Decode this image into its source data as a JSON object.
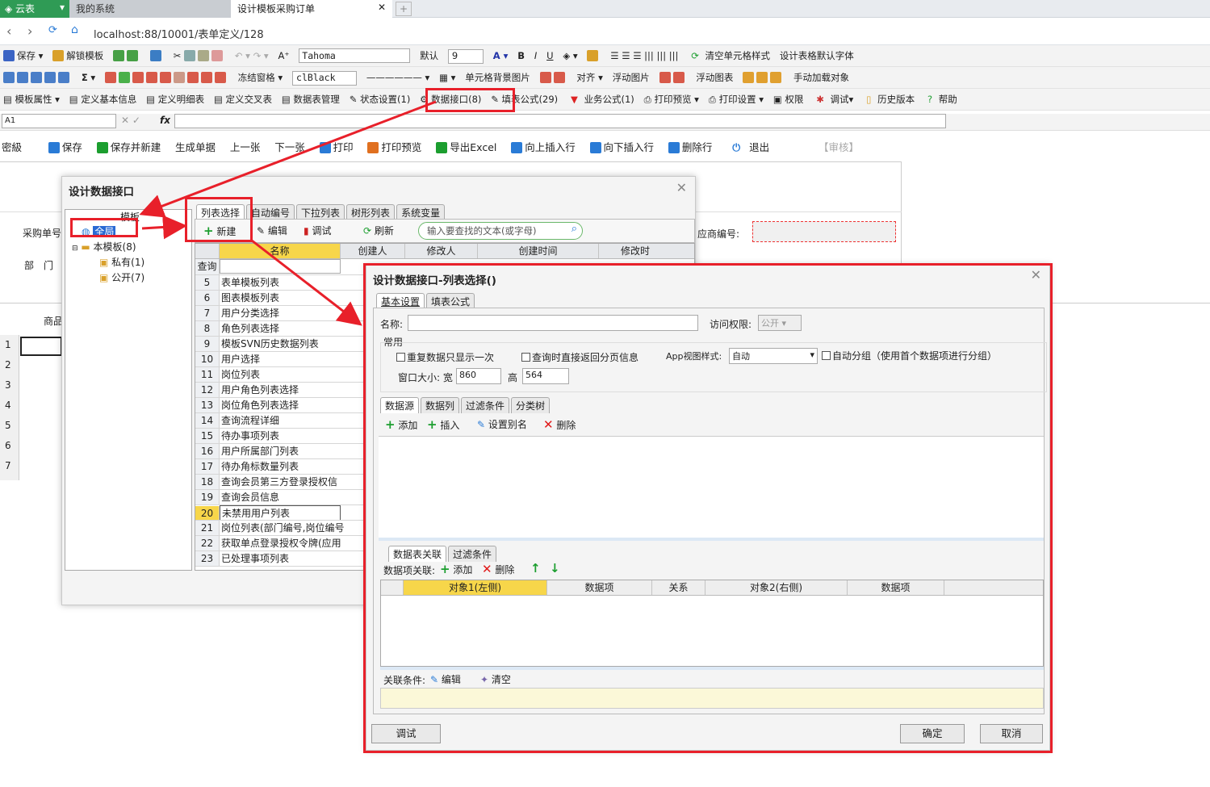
{
  "app": {
    "app_tab": "云表",
    "system_tab": "我的系统",
    "doc_tab": "设计模板采购订单",
    "url": "localhost:88/10001/表单定义/128"
  },
  "toolbar1": {
    "save": "保存",
    "unlock": "解锁模板",
    "font_label": "A⁺",
    "font_name": "Tahoma",
    "default": "默认",
    "size": "9",
    "clear_style": "清空单元格样式",
    "default_font": "设计表格默认字体",
    "B": "B",
    "I": "I",
    "U": "U"
  },
  "toolbar2": {
    "freeze": "冻结窗格",
    "color_name": "clBlack",
    "cell_bg": "单元格背景图片",
    "align": "对齐",
    "float_img": "浮动图片",
    "float_chart": "浮动图表",
    "manual_load": "手动加载对象",
    "sigma": "Σ"
  },
  "toolbar3": {
    "template_props": "模板属性",
    "define_basic": "定义基本信息",
    "define_detail": "定义明细表",
    "define_cross": "定义交叉表",
    "data_table": "数据表管理",
    "state": "状态设置(1)",
    "data_interface": "数据接口(8)",
    "fill_formula": "填表公式(29)",
    "biz_formula": "业务公式(1)",
    "print_preview": "打印预览",
    "print_settings": "打印设置",
    "permission": "权限",
    "debug": "调试",
    "history": "历史版本",
    "help": "帮助"
  },
  "formula": {
    "cell": "A1",
    "fx": "fx"
  },
  "actions": {
    "password": "密級",
    "save": "保存",
    "save_new": "保存并新建",
    "gen": "生成单据",
    "prev": "上一张",
    "next": "下一张",
    "print": "打印",
    "print_preview": "打印预览",
    "export": "导出Excel",
    "insert_up": "向上插入行",
    "insert_down": "向下插入行",
    "delete_row": "删除行",
    "exit": "退出",
    "review": "【审核】"
  },
  "sheet": {
    "label_po": "采购单号",
    "label_dept": "部　门",
    "label_goods": "商品",
    "label_supplier": "应商编号:",
    "rows": [
      "1",
      "2",
      "3",
      "4",
      "5",
      "6",
      "7"
    ]
  },
  "dlg1": {
    "title": "设计数据接口",
    "tree_header": "模板",
    "tree_global": "全局",
    "tree_this": "本模板(8)",
    "tree_private": "私有(1)",
    "tree_public": "公开(7)",
    "tabs": [
      "列表选择",
      "自动编号",
      "下拉列表",
      "树形列表",
      "系统变量"
    ],
    "new": "新建",
    "edit": "编辑",
    "debug": "调试",
    "refresh": "刷新",
    "search_placeholder": "输入要查找的文本(或字母)",
    "cols": [
      "名称",
      "创建人",
      "修改人",
      "创建时间",
      "修改时"
    ],
    "query": "查询",
    "rows": [
      {
        "n": "5",
        "name": "表单模板列表"
      },
      {
        "n": "6",
        "name": "图表模板列表"
      },
      {
        "n": "7",
        "name": "用户分类选择"
      },
      {
        "n": "8",
        "name": "角色列表选择"
      },
      {
        "n": "9",
        "name": "模板SVN历史数据列表"
      },
      {
        "n": "10",
        "name": "用户选择"
      },
      {
        "n": "11",
        "name": "岗位列表"
      },
      {
        "n": "12",
        "name": "用户角色列表选择"
      },
      {
        "n": "13",
        "name": "岗位角色列表选择"
      },
      {
        "n": "14",
        "name": "查询流程详细"
      },
      {
        "n": "15",
        "name": "待办事项列表"
      },
      {
        "n": "16",
        "name": "用户所属部门列表"
      },
      {
        "n": "17",
        "name": "待办角标数量列表"
      },
      {
        "n": "18",
        "name": "查询会员第三方登录授权信"
      },
      {
        "n": "19",
        "name": "查询会员信息"
      },
      {
        "n": "20",
        "name": "未禁用用户列表"
      },
      {
        "n": "21",
        "name": "岗位列表(部门编号,岗位编号"
      },
      {
        "n": "22",
        "name": "获取单点登录授权令牌(应用"
      },
      {
        "n": "23",
        "name": "已处理事项列表"
      }
    ]
  },
  "dlg2": {
    "title": "设计数据接口-列表选择()",
    "tabs": [
      "基本设置",
      "填表公式"
    ],
    "name_label": "名称:",
    "access_label": "访问权限:",
    "access_value": "公开",
    "group_common": "常用",
    "chk_dup": "重复数据只显示一次",
    "chk_page": "查询时直接返回分页信息",
    "app_style_label": "App视图样式:",
    "app_style_value": "自动",
    "chk_group": "自动分组（使用首个数据项进行分组）",
    "win_size": "窗口大小: 宽",
    "width": "860",
    "height_label": "高",
    "height": "564",
    "sub_tabs": [
      "数据源",
      "数据列",
      "过滤条件",
      "分类树"
    ],
    "add": "添加",
    "insert": "插入",
    "alias": "设置别名",
    "delete": "删除",
    "lower_tabs": [
      "数据表关联",
      "过滤条件"
    ],
    "assoc_label": "数据项关联:",
    "assoc_add": "添加",
    "assoc_delete": "删除",
    "assoc_cols": [
      "对象1(左侧)",
      "数据项",
      "关系",
      "对象2(右侧)",
      "数据项"
    ],
    "cond_label": "关联条件:",
    "cond_edit": "编辑",
    "cond_clear": "清空",
    "btn_debug": "调试",
    "btn_ok": "确定",
    "btn_cancel": "取消"
  },
  "colors": {
    "highlight": "#e8202a",
    "accent_green": "#2f9b55",
    "header_yellow": "#f7d64a"
  }
}
